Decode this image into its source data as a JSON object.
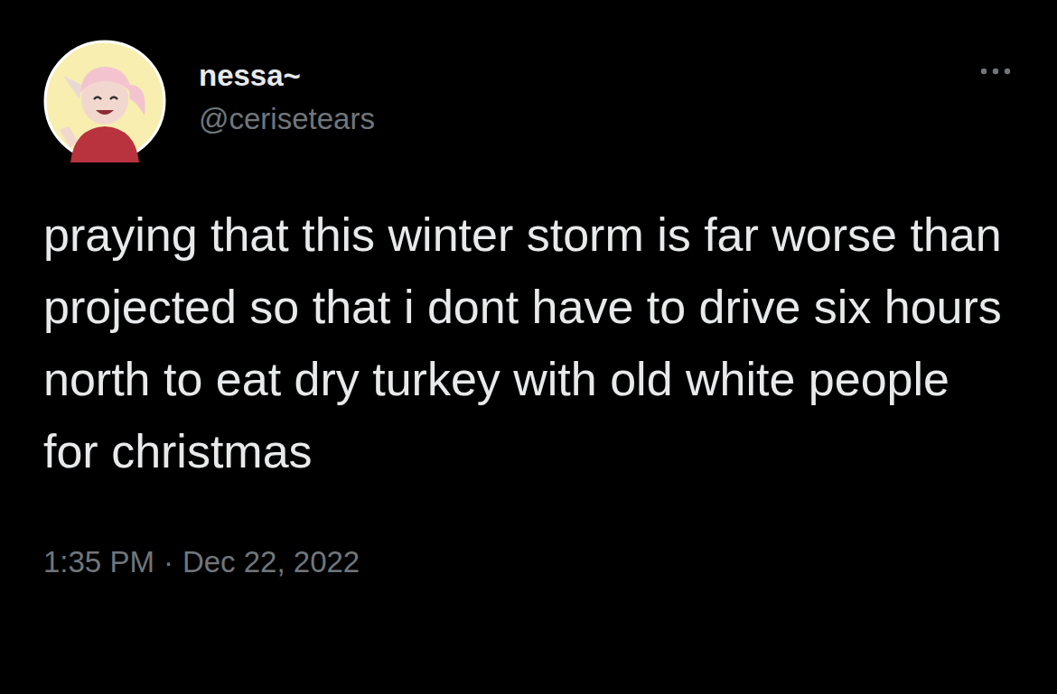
{
  "post": {
    "author": {
      "name": "nessa~",
      "handle": "@cerisetears"
    },
    "text": "praying that this winter storm is far worse than projected so that i dont have to drive six hours north to eat dry turkey with old white people for christmas",
    "time": "1:35 PM",
    "separator": "·",
    "date": "Dec 22, 2022"
  }
}
